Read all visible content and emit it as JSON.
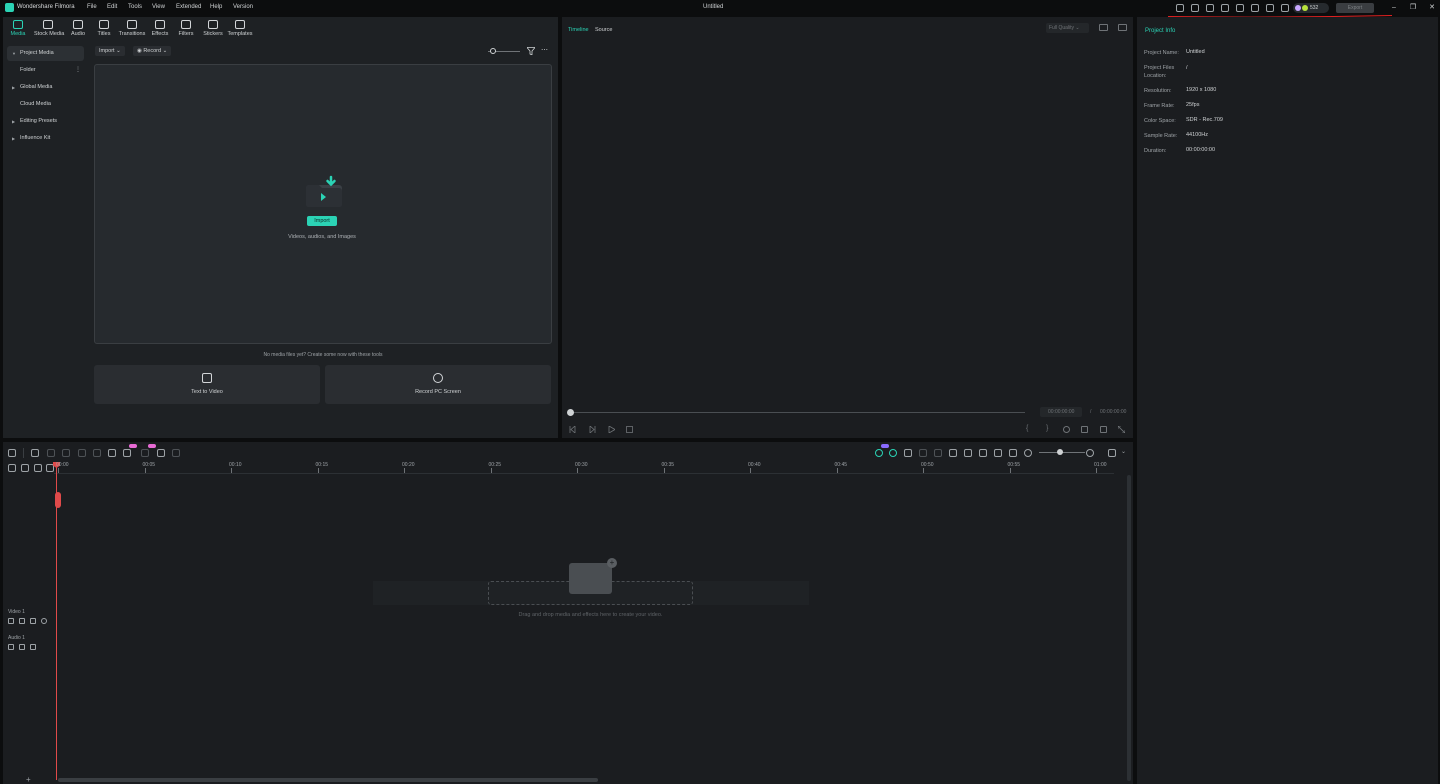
{
  "app": {
    "name": "Wondershare Filmora",
    "doc_title": "Untitled"
  },
  "menu": [
    "File",
    "Edit",
    "Tools",
    "View",
    "Extended",
    "Help",
    "Version"
  ],
  "titlebar": {
    "credits": "532",
    "export_label": "Export",
    "window_buttons": [
      "minimize",
      "restore",
      "close"
    ]
  },
  "media_tabs": [
    {
      "label": "Media",
      "icon": "media-icon",
      "active": true
    },
    {
      "label": "Stock Media",
      "icon": "stock-media-icon"
    },
    {
      "label": "Audio",
      "icon": "audio-icon"
    },
    {
      "label": "Titles",
      "icon": "titles-icon"
    },
    {
      "label": "Transitions",
      "icon": "transitions-icon"
    },
    {
      "label": "Effects",
      "icon": "effects-icon"
    },
    {
      "label": "Filters",
      "icon": "filters-icon"
    },
    {
      "label": "Stickers",
      "icon": "stickers-icon"
    },
    {
      "label": "Templates",
      "icon": "templates-icon"
    }
  ],
  "sidebar": [
    {
      "label": "Project Media",
      "active": true,
      "caret": true
    },
    {
      "label": "Folder",
      "sub": true
    },
    {
      "label": "Global Media",
      "caret": true
    },
    {
      "label": "Cloud Media"
    },
    {
      "label": "Editing Presets",
      "caret": true
    },
    {
      "label": "Influence Kit",
      "caret": true
    }
  ],
  "media": {
    "import_label": "Import",
    "record_label": "Record",
    "import_button": "Import",
    "drop_hint": "Videos, audios, and Images",
    "no_media": "No media files yet? Create some now with these tools",
    "tools": [
      {
        "label": "Text to Video",
        "icon": "text-to-video-icon"
      },
      {
        "label": "Record PC Screen",
        "icon": "record-screen-icon"
      }
    ]
  },
  "preview": {
    "tabs": [
      "Timeline",
      "Source"
    ],
    "quality": "Full Quality",
    "current_time": "00:00:00:00",
    "separator": "/",
    "total_time": "00:00:00:00"
  },
  "project_info": {
    "title": "Project Info",
    "rows": [
      {
        "label": "Project Name:",
        "value": "Untitled"
      },
      {
        "label": "Project Files Location:",
        "value": "/"
      },
      {
        "label": "Resolution:",
        "value": "1920 x 1080"
      },
      {
        "label": "Frame Rate:",
        "value": "25fps"
      },
      {
        "label": "Color Space:",
        "value": "SDR - Rec.709"
      },
      {
        "label": "Sample Rate:",
        "value": "44100Hz"
      },
      {
        "label": "Duration:",
        "value": "00:00:00:00"
      }
    ]
  },
  "timeline": {
    "ruler": [
      "00:00",
      "00:05",
      "00:10",
      "00:15",
      "00:20",
      "00:25",
      "00:30",
      "00:35",
      "00:40",
      "00:45",
      "00:50",
      "00:55",
      "01:00"
    ],
    "tracks": [
      {
        "label": "Video 1"
      },
      {
        "label": "Audio 1"
      }
    ],
    "drop_text": "Drag and drop media and effects here to create your video."
  },
  "colors": {
    "accent": "#2bd3b5",
    "playhead": "#e04a4a",
    "annotation": "#e02020",
    "badge": "#e86bd5"
  }
}
